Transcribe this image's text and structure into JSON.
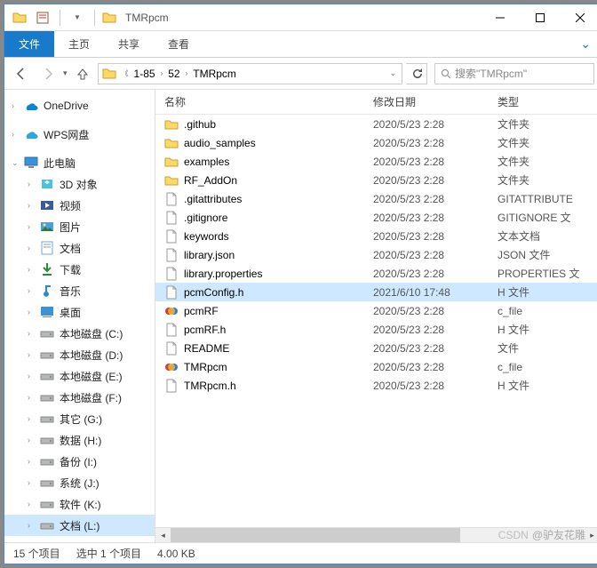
{
  "window": {
    "title": "TMRpcm"
  },
  "ribbon": {
    "file": "文件",
    "home": "主页",
    "share": "共享",
    "view": "查看"
  },
  "breadcrumb": [
    "1-85",
    "52",
    "TMRpcm"
  ],
  "search": {
    "placeholder": "搜索\"TMRpcm\""
  },
  "headers": {
    "name": "名称",
    "date": "修改日期",
    "type": "类型"
  },
  "sidebar": {
    "onedrive": "OneDrive",
    "wps": "WPS网盘",
    "thispc": "此电脑",
    "items": [
      "3D 对象",
      "视频",
      "图片",
      "文档",
      "下载",
      "音乐",
      "桌面",
      "本地磁盘 (C:)",
      "本地磁盘 (D:)",
      "本地磁盘 (E:)",
      "本地磁盘 (F:)",
      "其它 (G:)",
      "数据 (H:)",
      "备份 (I:)",
      "系统 (J:)",
      "软件 (K:)",
      "文档 (L:)"
    ]
  },
  "files": [
    {
      "name": ".github",
      "date": "2020/5/23 2:28",
      "type": "文件夹",
      "icon": "folder"
    },
    {
      "name": "audio_samples",
      "date": "2020/5/23 2:28",
      "type": "文件夹",
      "icon": "folder"
    },
    {
      "name": "examples",
      "date": "2020/5/23 2:28",
      "type": "文件夹",
      "icon": "folder"
    },
    {
      "name": "RF_AddOn",
      "date": "2020/5/23 2:28",
      "type": "文件夹",
      "icon": "folder"
    },
    {
      "name": ".gitattributes",
      "date": "2020/5/23 2:28",
      "type": "GITATTRIBUTE",
      "icon": "file"
    },
    {
      "name": ".gitignore",
      "date": "2020/5/23 2:28",
      "type": "GITIGNORE 文",
      "icon": "file"
    },
    {
      "name": "keywords",
      "date": "2020/5/23 2:28",
      "type": "文本文档",
      "icon": "file"
    },
    {
      "name": "library.json",
      "date": "2020/5/23 2:28",
      "type": "JSON 文件",
      "icon": "file"
    },
    {
      "name": "library.properties",
      "date": "2020/5/23 2:28",
      "type": "PROPERTIES 文",
      "icon": "file"
    },
    {
      "name": "pcmConfig.h",
      "date": "2021/6/10 17:48",
      "type": "H 文件",
      "icon": "file",
      "selected": true
    },
    {
      "name": "pcmRF",
      "date": "2020/5/23 2:28",
      "type": "c_file",
      "icon": "cfile"
    },
    {
      "name": "pcmRF.h",
      "date": "2020/5/23 2:28",
      "type": "H 文件",
      "icon": "file"
    },
    {
      "name": "README",
      "date": "2020/5/23 2:28",
      "type": "文件",
      "icon": "file"
    },
    {
      "name": "TMRpcm",
      "date": "2020/5/23 2:28",
      "type": "c_file",
      "icon": "cfile"
    },
    {
      "name": "TMRpcm.h",
      "date": "2020/5/23 2:28",
      "type": "H 文件",
      "icon": "file"
    }
  ],
  "status": {
    "count": "15 个项目",
    "selected": "选中 1 个项目",
    "size": "4.00 KB"
  },
  "watermark": {
    "csdn": "CSDN",
    "author": "@驴友花雕"
  }
}
